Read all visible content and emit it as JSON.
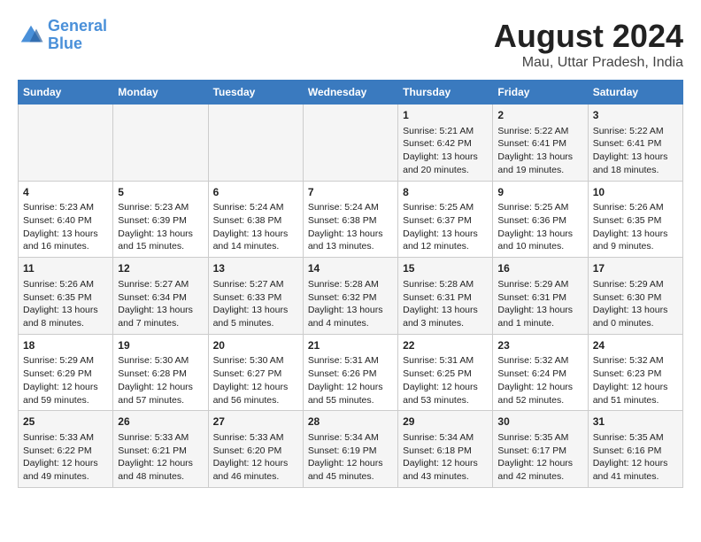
{
  "header": {
    "logo_line1": "General",
    "logo_line2": "Blue",
    "title": "August 2024",
    "subtitle": "Mau, Uttar Pradesh, India"
  },
  "days_of_week": [
    "Sunday",
    "Monday",
    "Tuesday",
    "Wednesday",
    "Thursday",
    "Friday",
    "Saturday"
  ],
  "weeks": [
    [
      {
        "day": "",
        "content": ""
      },
      {
        "day": "",
        "content": ""
      },
      {
        "day": "",
        "content": ""
      },
      {
        "day": "",
        "content": ""
      },
      {
        "day": "1",
        "content": "Sunrise: 5:21 AM\nSunset: 6:42 PM\nDaylight: 13 hours\nand 20 minutes."
      },
      {
        "day": "2",
        "content": "Sunrise: 5:22 AM\nSunset: 6:41 PM\nDaylight: 13 hours\nand 19 minutes."
      },
      {
        "day": "3",
        "content": "Sunrise: 5:22 AM\nSunset: 6:41 PM\nDaylight: 13 hours\nand 18 minutes."
      }
    ],
    [
      {
        "day": "4",
        "content": "Sunrise: 5:23 AM\nSunset: 6:40 PM\nDaylight: 13 hours\nand 16 minutes."
      },
      {
        "day": "5",
        "content": "Sunrise: 5:23 AM\nSunset: 6:39 PM\nDaylight: 13 hours\nand 15 minutes."
      },
      {
        "day": "6",
        "content": "Sunrise: 5:24 AM\nSunset: 6:38 PM\nDaylight: 13 hours\nand 14 minutes."
      },
      {
        "day": "7",
        "content": "Sunrise: 5:24 AM\nSunset: 6:38 PM\nDaylight: 13 hours\nand 13 minutes."
      },
      {
        "day": "8",
        "content": "Sunrise: 5:25 AM\nSunset: 6:37 PM\nDaylight: 13 hours\nand 12 minutes."
      },
      {
        "day": "9",
        "content": "Sunrise: 5:25 AM\nSunset: 6:36 PM\nDaylight: 13 hours\nand 10 minutes."
      },
      {
        "day": "10",
        "content": "Sunrise: 5:26 AM\nSunset: 6:35 PM\nDaylight: 13 hours\nand 9 minutes."
      }
    ],
    [
      {
        "day": "11",
        "content": "Sunrise: 5:26 AM\nSunset: 6:35 PM\nDaylight: 13 hours\nand 8 minutes."
      },
      {
        "day": "12",
        "content": "Sunrise: 5:27 AM\nSunset: 6:34 PM\nDaylight: 13 hours\nand 7 minutes."
      },
      {
        "day": "13",
        "content": "Sunrise: 5:27 AM\nSunset: 6:33 PM\nDaylight: 13 hours\nand 5 minutes."
      },
      {
        "day": "14",
        "content": "Sunrise: 5:28 AM\nSunset: 6:32 PM\nDaylight: 13 hours\nand 4 minutes."
      },
      {
        "day": "15",
        "content": "Sunrise: 5:28 AM\nSunset: 6:31 PM\nDaylight: 13 hours\nand 3 minutes."
      },
      {
        "day": "16",
        "content": "Sunrise: 5:29 AM\nSunset: 6:31 PM\nDaylight: 13 hours\nand 1 minute."
      },
      {
        "day": "17",
        "content": "Sunrise: 5:29 AM\nSunset: 6:30 PM\nDaylight: 13 hours\nand 0 minutes."
      }
    ],
    [
      {
        "day": "18",
        "content": "Sunrise: 5:29 AM\nSunset: 6:29 PM\nDaylight: 12 hours\nand 59 minutes."
      },
      {
        "day": "19",
        "content": "Sunrise: 5:30 AM\nSunset: 6:28 PM\nDaylight: 12 hours\nand 57 minutes."
      },
      {
        "day": "20",
        "content": "Sunrise: 5:30 AM\nSunset: 6:27 PM\nDaylight: 12 hours\nand 56 minutes."
      },
      {
        "day": "21",
        "content": "Sunrise: 5:31 AM\nSunset: 6:26 PM\nDaylight: 12 hours\nand 55 minutes."
      },
      {
        "day": "22",
        "content": "Sunrise: 5:31 AM\nSunset: 6:25 PM\nDaylight: 12 hours\nand 53 minutes."
      },
      {
        "day": "23",
        "content": "Sunrise: 5:32 AM\nSunset: 6:24 PM\nDaylight: 12 hours\nand 52 minutes."
      },
      {
        "day": "24",
        "content": "Sunrise: 5:32 AM\nSunset: 6:23 PM\nDaylight: 12 hours\nand 51 minutes."
      }
    ],
    [
      {
        "day": "25",
        "content": "Sunrise: 5:33 AM\nSunset: 6:22 PM\nDaylight: 12 hours\nand 49 minutes."
      },
      {
        "day": "26",
        "content": "Sunrise: 5:33 AM\nSunset: 6:21 PM\nDaylight: 12 hours\nand 48 minutes."
      },
      {
        "day": "27",
        "content": "Sunrise: 5:33 AM\nSunset: 6:20 PM\nDaylight: 12 hours\nand 46 minutes."
      },
      {
        "day": "28",
        "content": "Sunrise: 5:34 AM\nSunset: 6:19 PM\nDaylight: 12 hours\nand 45 minutes."
      },
      {
        "day": "29",
        "content": "Sunrise: 5:34 AM\nSunset: 6:18 PM\nDaylight: 12 hours\nand 43 minutes."
      },
      {
        "day": "30",
        "content": "Sunrise: 5:35 AM\nSunset: 6:17 PM\nDaylight: 12 hours\nand 42 minutes."
      },
      {
        "day": "31",
        "content": "Sunrise: 5:35 AM\nSunset: 6:16 PM\nDaylight: 12 hours\nand 41 minutes."
      }
    ]
  ]
}
